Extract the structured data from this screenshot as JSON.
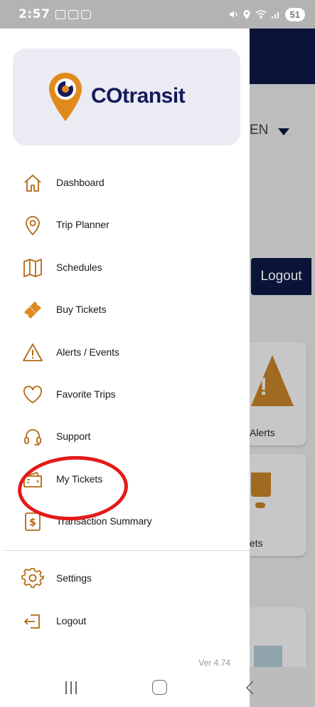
{
  "status_bar": {
    "time": "2:57",
    "battery": "51"
  },
  "brand": {
    "logo_text": "COtransit",
    "accent_color": "#e08a1e",
    "navy_color": "#141a5a"
  },
  "menu": {
    "items": [
      {
        "label": "Dashboard",
        "icon": "home-icon"
      },
      {
        "label": "Trip Planner",
        "icon": "location-pin-icon"
      },
      {
        "label": "Schedules",
        "icon": "map-icon"
      },
      {
        "label": "Buy Tickets",
        "icon": "ticket-icon"
      },
      {
        "label": "Alerts / Events",
        "icon": "warning-icon"
      },
      {
        "label": "Favorite Trips",
        "icon": "heart-icon"
      },
      {
        "label": "Support",
        "icon": "headset-icon"
      },
      {
        "label": "My Tickets",
        "icon": "wallet-icon"
      },
      {
        "label": "Transaction Summary",
        "icon": "dollar-icon"
      }
    ],
    "footer_items": [
      {
        "label": "Settings",
        "icon": "gear-icon"
      },
      {
        "label": "Logout",
        "icon": "logout-icon"
      }
    ],
    "version": "Ver 4.74"
  },
  "background": {
    "language": "EN",
    "logout_label": "Logout",
    "card1_label": "Alerts",
    "card2_label": "ets"
  }
}
